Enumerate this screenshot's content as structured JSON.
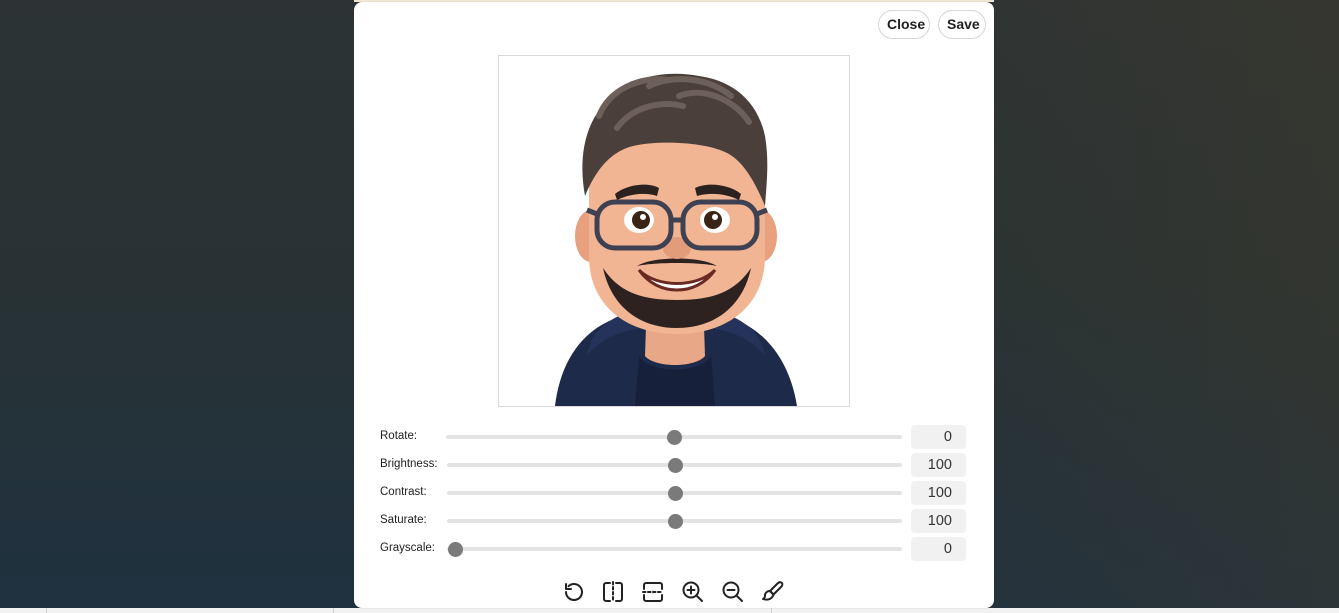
{
  "header": {
    "close_label": "Close",
    "save_label": "Save"
  },
  "image": {
    "subject": "3D cartoon avatar of a man with glasses and beard wearing a navy hoodie"
  },
  "adjustments": [
    {
      "label": "Rotate:",
      "value": "0",
      "level": 0.5
    },
    {
      "label": "Brightness:",
      "value": "100",
      "level": 0.5
    },
    {
      "label": "Contrast:",
      "value": "100",
      "level": 0.5
    },
    {
      "label": "Saturate:",
      "value": "100",
      "level": 0.5
    },
    {
      "label": "Grayscale:",
      "value": "0",
      "level": 0.0
    }
  ],
  "toolbar": {
    "tools": [
      {
        "icon": "rotate-left-icon"
      },
      {
        "icon": "flip-horizontal-icon"
      },
      {
        "icon": "flip-vertical-icon"
      },
      {
        "icon": "zoom-in-icon"
      },
      {
        "icon": "zoom-out-icon"
      },
      {
        "icon": "brush-icon"
      }
    ]
  },
  "colors": {
    "thumb": "#7a7a7a",
    "track": "#e3e3e3",
    "value_bg": "#f1f1f1"
  }
}
